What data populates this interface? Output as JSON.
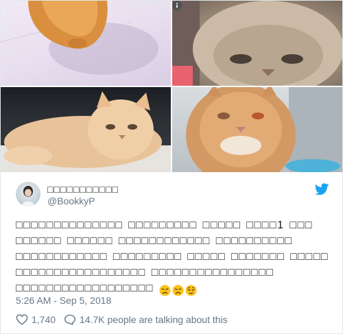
{
  "tweet": {
    "display_name": "□□□□□□□□□□□",
    "handle": "@BookkyP",
    "text": "□□□□□□□□□□□□□□ □□□□□□□□□ □□□□□ □□□□1 □□□ □□□□□□ □□□□□□ □□□□□□□□□□□□  □□□□□□□□□□ □□□□□□□□□□□□ □□□□□□□□□ □□□□□ □□□□□□□ □□□□□ □□□□□□□□□□□□□□□□□ □□□□□□□□□□□□□□□□ □□□□□□□□□□□□□□□□□□",
    "emojis": [
      "disappointed-face",
      "disappointed-face",
      "relieved-face"
    ],
    "timestamp": "5:26 AM - Sep 5, 2018",
    "likes": "1,740",
    "talking": "14.7K people are talking about this"
  },
  "colors": {
    "twitter_blue": "#1da1f2",
    "secondary_text": "#657786",
    "border": "#e1e8ed"
  },
  "icons": {
    "info": "info-icon",
    "brand": "twitter-bird-icon",
    "like": "heart-icon",
    "reply": "speech-bubble-icon"
  }
}
